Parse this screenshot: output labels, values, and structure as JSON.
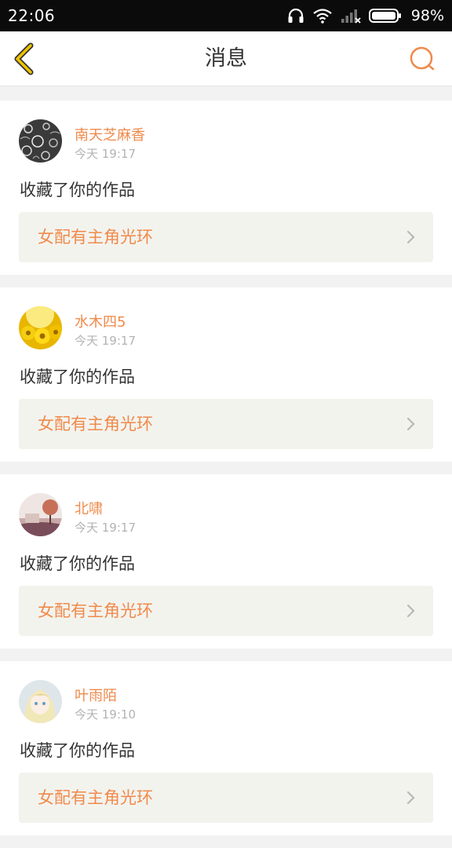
{
  "status_bar": {
    "time": "22:06",
    "battery": "98%",
    "icons": [
      "headphones-icon",
      "wifi-icon",
      "signal-icon",
      "battery-icon"
    ]
  },
  "header": {
    "title": "消息",
    "back_icon": "chevron-left-icon",
    "search_icon": "search-icon",
    "accent_color": "#f08a4b",
    "back_color": "#f0c200"
  },
  "messages": [
    {
      "user": "南天芝麻香",
      "time": "今天 19:17",
      "text": "收藏了你的作品",
      "work": "女配有主角光环"
    },
    {
      "user": "水木四5",
      "time": "今天 19:17",
      "text": "收藏了你的作品",
      "work": "女配有主角光环"
    },
    {
      "user": "北啸",
      "time": "今天 19:17",
      "text": "收藏了你的作品",
      "work": "女配有主角光环"
    },
    {
      "user": "叶雨陌",
      "time": "今天 19:10",
      "text": "收藏了你的作品",
      "work": "女配有主角光环"
    }
  ]
}
